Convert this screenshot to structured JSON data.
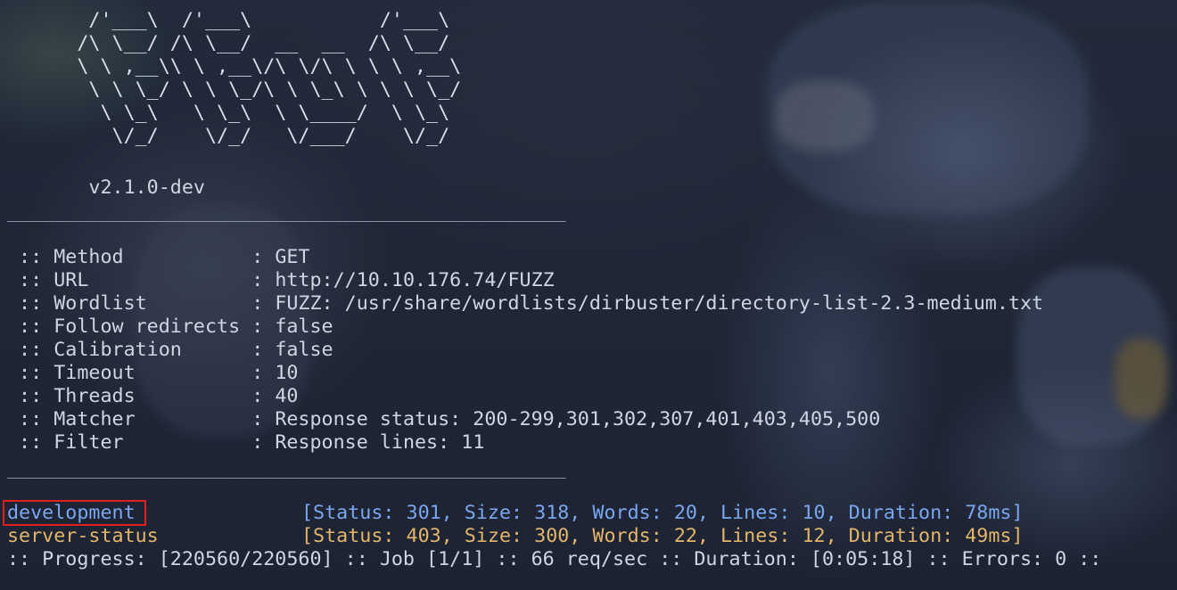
{
  "banner": {
    "ascii_art": "       /'___\\  /'___\\           /'___\\       \n      /\\ \\__/ /\\ \\__/  __  __  /\\ \\__/       \n      \\ \\ ,__\\\\ \\ ,__\\/\\ \\/\\ \\ \\ \\ ,__\\      \n       \\ \\ \\_/ \\ \\ \\_/\\ \\ \\_\\ \\ \\ \\ \\_/      \n        \\ \\_\\   \\ \\_\\  \\ \\____/  \\ \\_\\       \n         \\/_/    \\/_/   \\/___/    \\/_/       ",
    "version": "       v2.1.0-dev"
  },
  "separator": "________________________________________________",
  "config": [
    {
      "key": " :: Method           ",
      "value": ": GET"
    },
    {
      "key": " :: URL              ",
      "value": ": http://10.10.176.74/FUZZ"
    },
    {
      "key": " :: Wordlist         ",
      "value": ": FUZZ: /usr/share/wordlists/dirbuster/directory-list-2.3-medium.txt"
    },
    {
      "key": " :: Follow redirects ",
      "value": ": false"
    },
    {
      "key": " :: Calibration      ",
      "value": ": false"
    },
    {
      "key": " :: Timeout          ",
      "value": ": 10"
    },
    {
      "key": " :: Threads          ",
      "value": ": 40"
    },
    {
      "key": " :: Matcher          ",
      "value": ": Response status: 200-299,301,302,307,401,403,405,500"
    },
    {
      "key": " :: Filter           ",
      "value": ": Response lines: 11"
    }
  ],
  "results": [
    {
      "path": "development",
      "details": "[Status: 301, Size: 318, Words: 20, Lines: 10, Duration: 78ms]",
      "color": "#7aa7ee"
    },
    {
      "path": "server-status",
      "details": "[Status: 403, Size: 300, Words: 22, Lines: 12, Duration: 49ms]",
      "color": "#e2b56a"
    }
  ],
  "progress": ":: Progress: [220560/220560] :: Job [1/1] :: 66 req/sec :: Duration: [0:05:18] :: Errors: 0 ::",
  "highlight_color": "#e0201f"
}
